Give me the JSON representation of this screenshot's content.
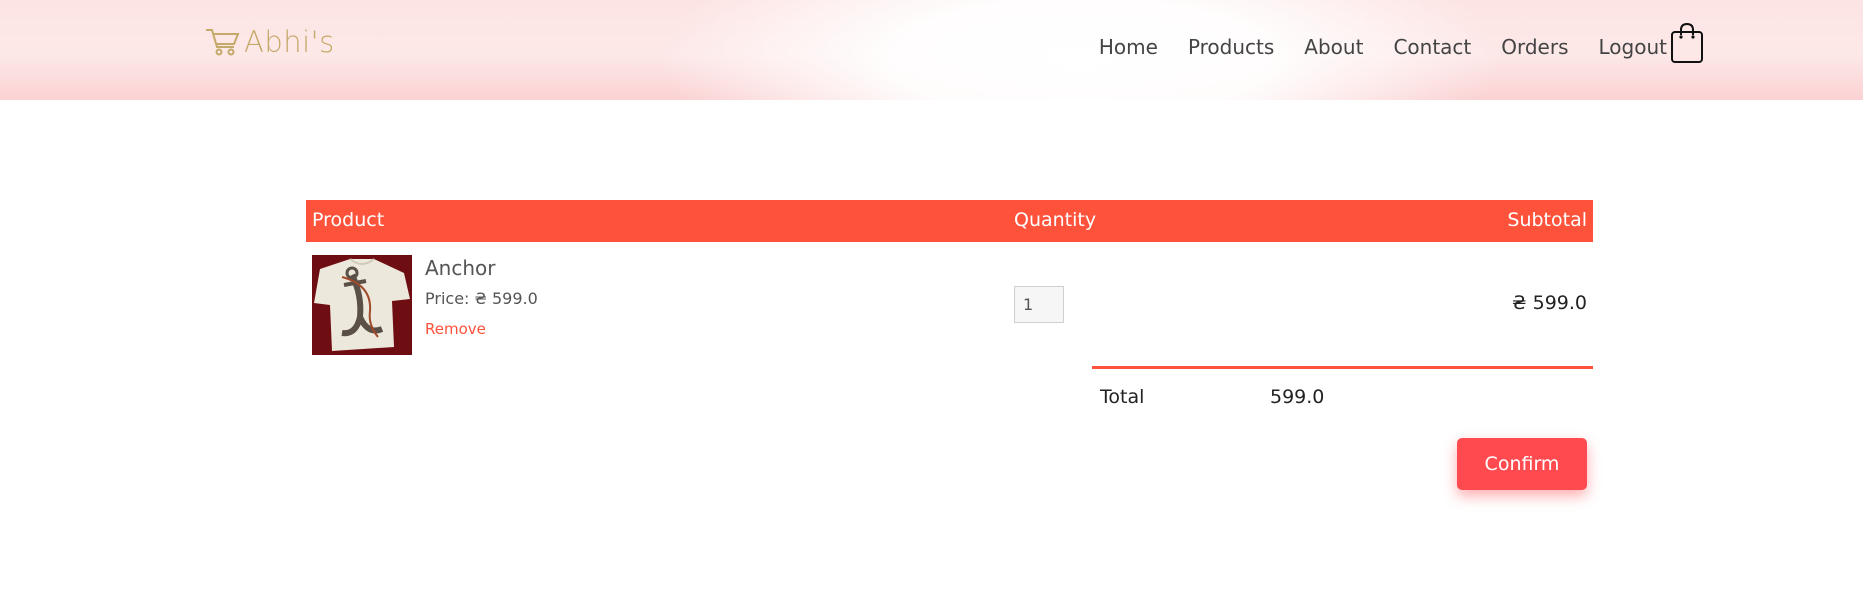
{
  "brand": {
    "name": "Abhi's"
  },
  "nav": {
    "items": [
      "Home",
      "Products",
      "About",
      "Contact",
      "Orders",
      "Logout"
    ]
  },
  "table": {
    "headers": {
      "product": "Product",
      "quantity": "Quantity",
      "subtotal": "Subtotal"
    },
    "rows": [
      {
        "name": "Anchor",
        "price": "Price: ₴ 599.0",
        "remove_label": "Remove",
        "quantity": "1",
        "subtotal": "₴ 599.0"
      }
    ]
  },
  "totals": {
    "label": "Total",
    "value": "599.0"
  },
  "actions": {
    "confirm_label": "Confirm"
  },
  "colors": {
    "accent": "#ff523b",
    "confirm": "#ff4a4f",
    "brand": "#c5a968",
    "nav_text": "#444444"
  },
  "icons": {
    "logo": "cart-icon",
    "header_cart": "shopping-bag-icon"
  }
}
